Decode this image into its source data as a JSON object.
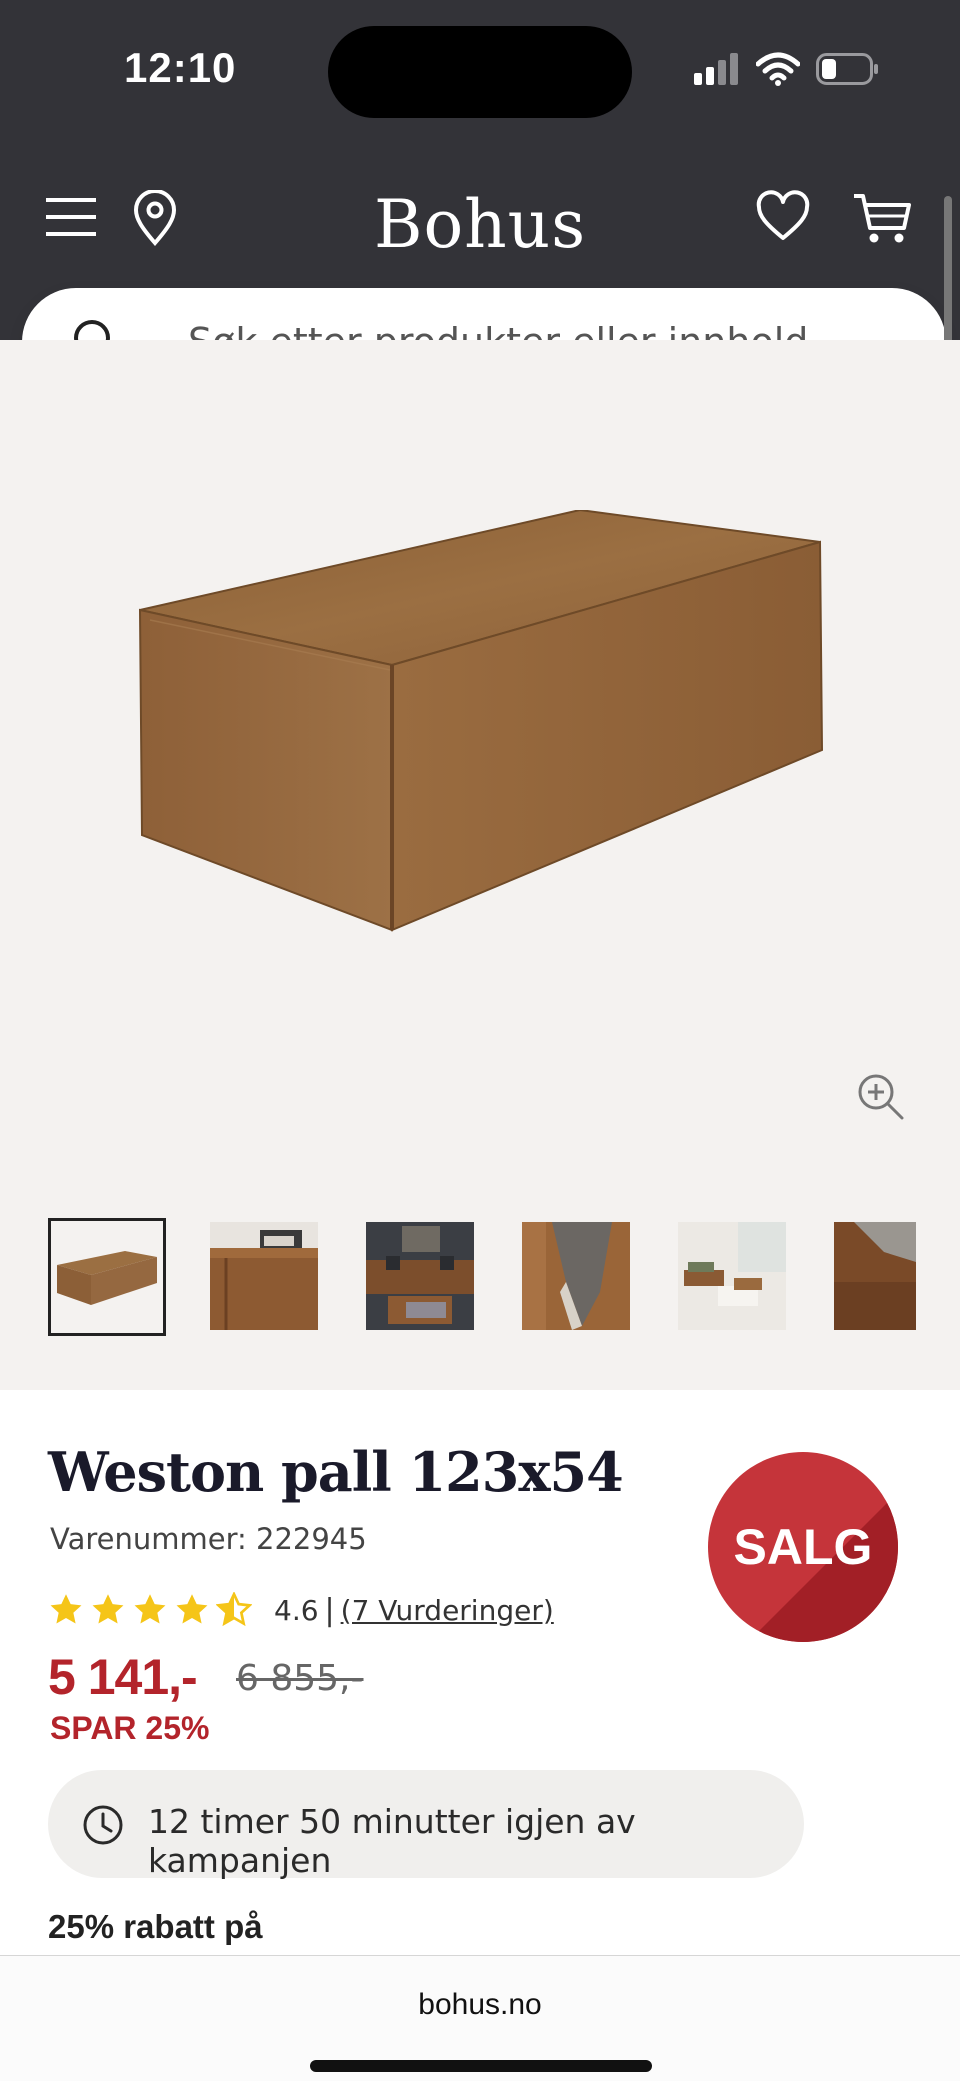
{
  "status_bar": {
    "time": "12:10"
  },
  "header": {
    "brand": "Bohus",
    "search_placeholder": "Søk etter produkter eller innhold..."
  },
  "icons": {
    "menu": "hamburger-menu-icon",
    "location": "map-pin-icon",
    "wishlist": "heart-icon",
    "cart": "shopping-cart-icon",
    "search": "search-icon",
    "zoom": "zoom-in-icon",
    "timer": "clock-icon"
  },
  "gallery": {
    "thumbnail_count": 6,
    "active_index": 0
  },
  "product": {
    "title": "Weston pall 123x54",
    "sku_label": "Varenummer: 222945",
    "rating_value": "4.6",
    "rating_separator": "|",
    "rating_link": "(7 Vurderinger)",
    "rating_stars": 4.6,
    "price": "5 141,-",
    "old_price": "6 855,-",
    "save_text": "SPAR 25%",
    "badge": "SALG",
    "campaign_text": "12 timer 50 minutter igjen av kampanjen",
    "discount_heading": "25% rabatt på"
  },
  "colors": {
    "header_bg": "#333338",
    "sale_red": "#b3242b",
    "star": "#f5c518",
    "leather": "#9a6a3a"
  },
  "browser": {
    "url": "bohus.no"
  }
}
